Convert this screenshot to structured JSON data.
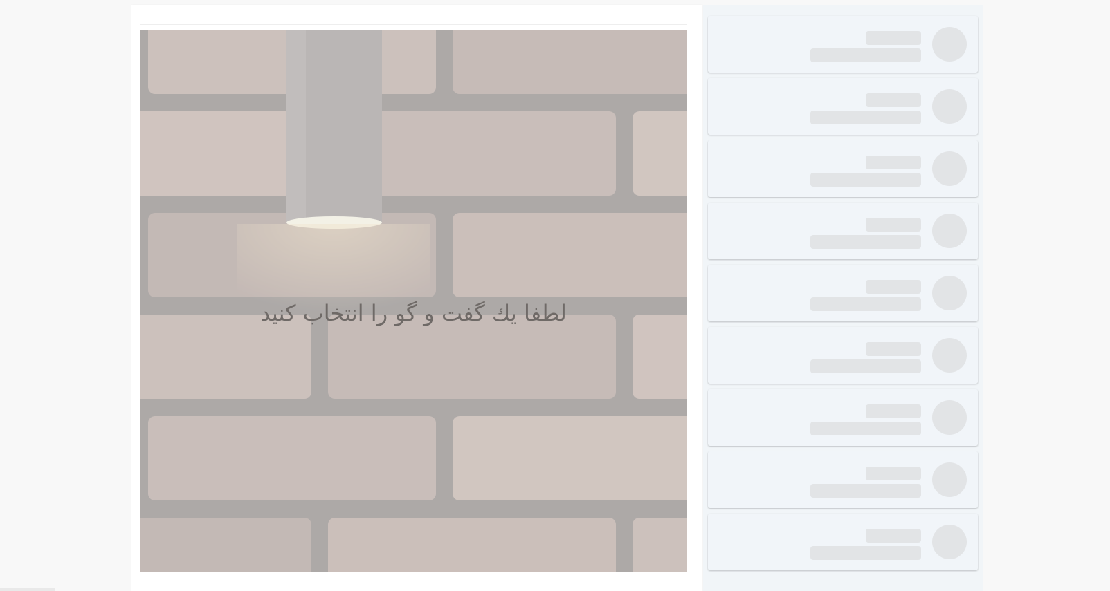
{
  "chat": {
    "empty_message": "لطفا یك گفت و گو را انتخاب كنید",
    "background": "brick-wall-with-lamp"
  },
  "conversations": {
    "state": "loading",
    "items": [
      {
        "name": "",
        "preview": ""
      },
      {
        "name": "",
        "preview": ""
      },
      {
        "name": "",
        "preview": ""
      },
      {
        "name": "",
        "preview": ""
      },
      {
        "name": "",
        "preview": ""
      },
      {
        "name": "",
        "preview": ""
      },
      {
        "name": "",
        "preview": ""
      },
      {
        "name": "",
        "preview": ""
      },
      {
        "name": "",
        "preview": ""
      }
    ]
  },
  "colors": {
    "page_bg": "#f8f8f8",
    "panel_bg": "#ffffff",
    "list_bg": "#f1f5f8",
    "skeleton": "#e2e4e6",
    "text": "#6f6a67"
  }
}
